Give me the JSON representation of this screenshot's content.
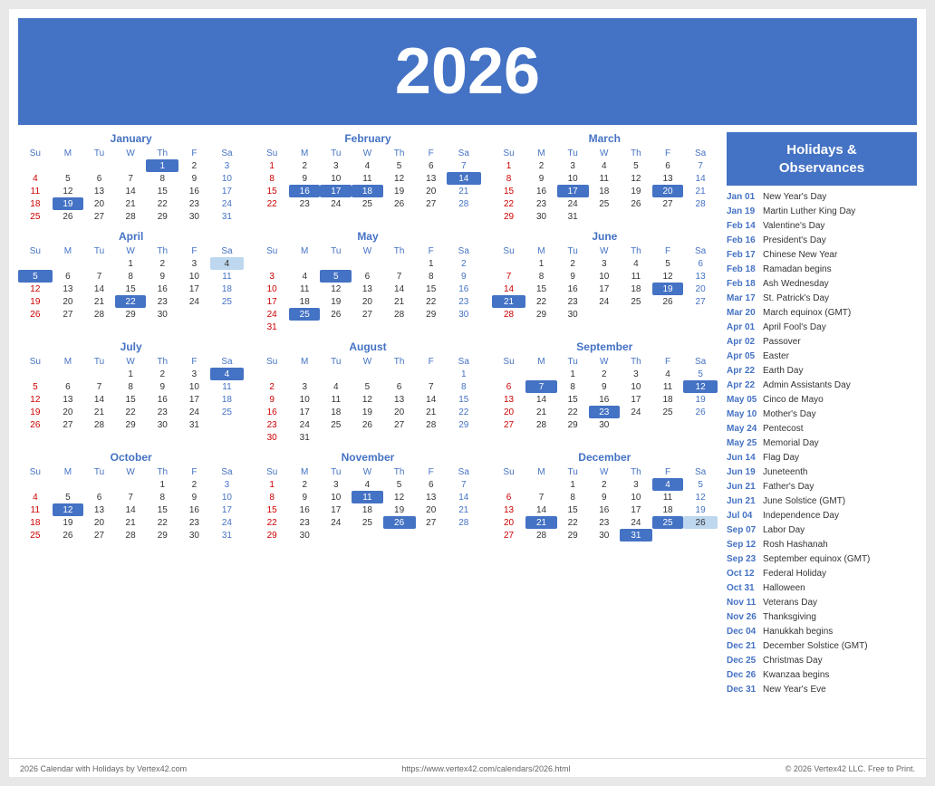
{
  "header": {
    "year": "2026"
  },
  "holidays_title": "Holidays &\nObservances",
  "holidays": [
    {
      "date": "Jan 01",
      "name": "New Year's Day"
    },
    {
      "date": "Jan 19",
      "name": "Martin Luther King Day"
    },
    {
      "date": "Feb 14",
      "name": "Valentine's Day"
    },
    {
      "date": "Feb 16",
      "name": "President's Day"
    },
    {
      "date": "Feb 17",
      "name": "Chinese New Year"
    },
    {
      "date": "Feb 18",
      "name": "Ramadan begins"
    },
    {
      "date": "Feb 18",
      "name": "Ash Wednesday"
    },
    {
      "date": "Mar 17",
      "name": "St. Patrick's Day"
    },
    {
      "date": "Mar 20",
      "name": "March equinox (GMT)"
    },
    {
      "date": "Apr 01",
      "name": "April Fool's Day"
    },
    {
      "date": "Apr 02",
      "name": "Passover"
    },
    {
      "date": "Apr 05",
      "name": "Easter"
    },
    {
      "date": "Apr 22",
      "name": "Earth Day"
    },
    {
      "date": "Apr 22",
      "name": "Admin Assistants Day"
    },
    {
      "date": "May 05",
      "name": "Cinco de Mayo"
    },
    {
      "date": "May 10",
      "name": "Mother's Day"
    },
    {
      "date": "May 24",
      "name": "Pentecost"
    },
    {
      "date": "May 25",
      "name": "Memorial Day"
    },
    {
      "date": "Jun 14",
      "name": "Flag Day"
    },
    {
      "date": "Jun 19",
      "name": "Juneteenth"
    },
    {
      "date": "Jun 21",
      "name": "Father's Day"
    },
    {
      "date": "Jun 21",
      "name": "June Solstice (GMT)"
    },
    {
      "date": "Jul 04",
      "name": "Independence Day"
    },
    {
      "date": "Sep 07",
      "name": "Labor Day"
    },
    {
      "date": "Sep 12",
      "name": "Rosh Hashanah"
    },
    {
      "date": "Sep 23",
      "name": "September equinox (GMT)"
    },
    {
      "date": "Oct 12",
      "name": "Federal Holiday"
    },
    {
      "date": "Oct 31",
      "name": "Halloween"
    },
    {
      "date": "Nov 11",
      "name": "Veterans Day"
    },
    {
      "date": "Nov 26",
      "name": "Thanksgiving"
    },
    {
      "date": "Dec 04",
      "name": "Hanukkah begins"
    },
    {
      "date": "Dec 21",
      "name": "December Solstice (GMT)"
    },
    {
      "date": "Dec 25",
      "name": "Christmas Day"
    },
    {
      "date": "Dec 26",
      "name": "Kwanzaa begins"
    },
    {
      "date": "Dec 31",
      "name": "New Year's Eve"
    }
  ],
  "footer": {
    "left": "2026 Calendar with Holidays by Vertex42.com",
    "center": "https://www.vertex42.com/calendars/2026.html",
    "right": "© 2026 Vertex42 LLC. Free to Print."
  }
}
